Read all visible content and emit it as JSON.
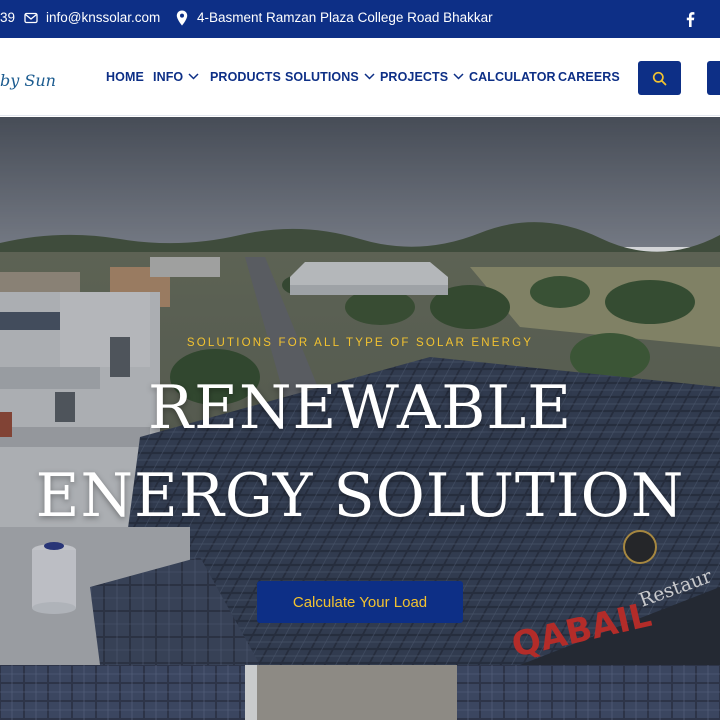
{
  "topbar": {
    "phone_fragment": "39",
    "email": "info@knssolar.com",
    "address": "4-Basment Ramzan Plaza College Road Bhakkar",
    "icons": {
      "email": "envelope-icon",
      "location": "map-pin-icon",
      "social": "facebook-icon"
    }
  },
  "header": {
    "logo_fragment": "by Sun",
    "nav": [
      {
        "label": "HOME",
        "dropdown": false
      },
      {
        "label": "INFO",
        "dropdown": true
      },
      {
        "label": "PRODUCTS",
        "dropdown": false
      },
      {
        "label": "SOLUTIONS",
        "dropdown": true
      },
      {
        "label": "PROJECTS",
        "dropdown": true
      },
      {
        "label": "CALCULATOR",
        "dropdown": false
      },
      {
        "label": "CAREERS",
        "dropdown": false
      }
    ],
    "search_icon": "search-icon"
  },
  "hero": {
    "kicker": "SOLUTIONS FOR ALL TYPE OF SOLAR ENERGY",
    "headline_line1": "RENEWABLE",
    "headline_line2": "ENERGY SOLUTION",
    "cta_label": "Calculate Your Load",
    "background_sign": "QABAIL Restaurant"
  },
  "colors": {
    "brand_blue": "#0d2f86",
    "accent_yellow": "#f2c230",
    "sign_red": "#d8322b",
    "white": "#ffffff"
  }
}
